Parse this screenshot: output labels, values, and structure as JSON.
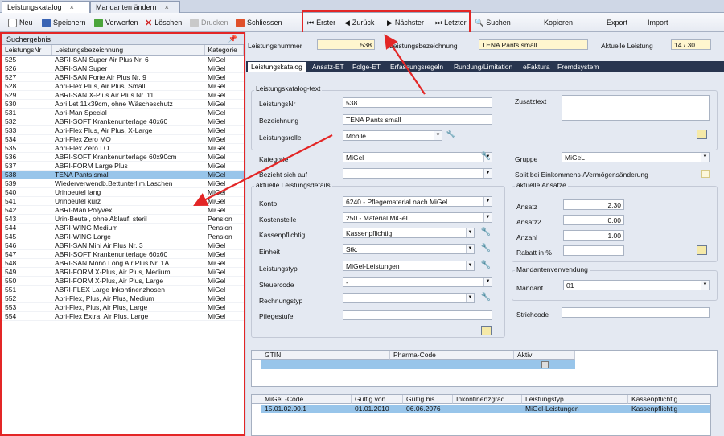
{
  "doc_tabs": [
    {
      "label": "Leistungskatalog",
      "close": "×"
    },
    {
      "label": "Mandanten ändern",
      "close": "×"
    }
  ],
  "toolbar": {
    "neu": "Neu",
    "speichern": "Speichern",
    "verwerfen": "Verwerfen",
    "loeschen": "Löschen",
    "drucken": "Drucken",
    "schliessen": "Schliessen",
    "erster": "Erster",
    "zurueck": "Zurück",
    "naechster": "Nächster",
    "letzter": "Letzter",
    "suchen": "Suchen",
    "kopieren": "Kopieren",
    "export": "Export",
    "import": "Import"
  },
  "left": {
    "title": "Suchergebnis",
    "columns": [
      "LeistungsNr",
      "Leistungsbezeichnung",
      "Kategorie"
    ],
    "rows": [
      [
        "525",
        "ABRI-SAN Super Air Plus Nr. 6",
        "MiGel"
      ],
      [
        "526",
        "ABRI-SAN Super",
        "MiGel"
      ],
      [
        "527",
        "ABRI-SAN Forte Air Plus Nr. 9",
        "MiGel"
      ],
      [
        "528",
        "Abri-Flex Plus, Air Plus, Small",
        "MiGel"
      ],
      [
        "529",
        "ABRI-SAN X-Plus Air Plus Nr. 11",
        "MiGel"
      ],
      [
        "530",
        "Abri Let 11x39cm, ohne Wäscheschutz",
        "MiGel"
      ],
      [
        "531",
        "Abri-Man Special",
        "MiGel"
      ],
      [
        "532",
        "ABRI-SOFT Krankenunterlage 40x60",
        "MiGel"
      ],
      [
        "533",
        "Abri-Flex Plus, Air Plus, X-Large",
        "MiGel"
      ],
      [
        "534",
        "Abri-Flex Zero MO",
        "MiGel"
      ],
      [
        "535",
        "Abri-Flex Zero LO",
        "MiGel"
      ],
      [
        "536",
        "ABRI-SOFT Krankenunterlage 60x90cm",
        "MiGel"
      ],
      [
        "537",
        "ABRI-FORM Large Plus",
        "MiGel"
      ],
      [
        "538",
        "TENA Pants small",
        "MiGel"
      ],
      [
        "539",
        "Wiederverwendb.Bettunterl.m.Laschen",
        "MiGel"
      ],
      [
        "540",
        "Urinbeutel lang",
        "MiGel"
      ],
      [
        "541",
        "Urinbeutel kurz",
        "MiGel"
      ],
      [
        "542",
        "ABRI-Man Polyvex",
        "MiGel"
      ],
      [
        "543",
        "Urin-Beutel, ohne Ablauf, steril",
        "Pension"
      ],
      [
        "544",
        "ABRI-WING Medium",
        "Pension"
      ],
      [
        "545",
        "ABRI-WING Large",
        "Pension"
      ],
      [
        "546",
        "ABRI-SAN Mini Air Plus Nr. 3",
        "MiGel"
      ],
      [
        "547",
        "ABRI-SOFT Krankenunterlage 60x60",
        "MiGel"
      ],
      [
        "548",
        "ABRI-SAN Mono Long Air Plus Nr. 1A",
        "MiGel"
      ],
      [
        "549",
        "ABRI-FORM  X-Plus, Air Plus, Medium",
        "MiGel"
      ],
      [
        "550",
        "ABRI-FORM X-Plus, Air Plus, Large",
        "MiGel"
      ],
      [
        "551",
        "ABRI-FLEX Large Inkontinenzhosen",
        "MiGel"
      ],
      [
        "552",
        "Abri-Flex, Plus, Air Plus, Medium",
        "MiGel"
      ],
      [
        "553",
        "Abri-Flex, Plus, Air Plus, Large",
        "MiGel"
      ],
      [
        "554",
        "Abri-Flex Extra, Air Plus, Large",
        "MiGel"
      ]
    ],
    "selected_index": 13
  },
  "header": {
    "nr_label": "Leistungsnummer",
    "nr_value": "538",
    "bez_label": "Leistungsbezeichnung",
    "bez_value": "TENA Pants small",
    "akt_label": "Aktuelle Leistung",
    "akt_value": "14 / 30"
  },
  "subtabs": [
    "Leistungskatalog",
    "Ansatz-ET",
    "Folge-ET",
    "Erfassungsregeln",
    "Rundung/Limitation",
    "eFaktura",
    "Fremdsystem"
  ],
  "form": {
    "grp_text": "Leistungskatalog-text",
    "nr_label": "LeistungsNr",
    "nr": "538",
    "bez_label": "Bezeichnung",
    "bez": "TENA Pants small",
    "rolle_label": "Leistungsrolle",
    "rolle": "Mobile",
    "zusatz_label": "Zusatztext",
    "kategorie_label": "Kategorie",
    "kategorie": "MiGel",
    "gruppe_label": "Gruppe",
    "gruppe": "MiGeL",
    "bezieht_label": "Bezieht sich auf",
    "split_label": "Split bei Einkommens-/Vermögensänderung",
    "grp_details": "aktuelle Leistungsdetails",
    "konto_label": "Konto",
    "konto": "6240 - Pflegematerial nach MiGel",
    "kst_label": "Kostenstelle",
    "kst": "250 - Material MiGeL",
    "kp_label": "Kassenpflichtig",
    "kp": "Kassenpflichtig",
    "einheit_label": "Einheit",
    "einheit": "Stk.",
    "typ_label": "Leistungstyp",
    "typ": "MiGel-Leistungen",
    "steuer_label": "Steuercode",
    "steuer": "-",
    "rtyp_label": "Rechnungstyp",
    "pflege_label": "Pflegestufe",
    "grp_ansaetze": "aktuelle Ansätze",
    "ansatz_label": "Ansatz",
    "ansatz": "2.30",
    "ansatz2_label": "Ansatz2",
    "ansatz2": "0.00",
    "anzahl_label": "Anzahl",
    "anzahl": "1.00",
    "rabatt_label": "Rabatt in %",
    "grp_mandant": "Mandantenverwendung",
    "mandant_label": "Mandant",
    "mandant": "01",
    "strich_label": "Strichcode"
  },
  "gtin_grid": {
    "columns": [
      "GTIN",
      "Pharma-Code",
      "Aktiv"
    ]
  },
  "migel_grid": {
    "columns": [
      "MiGeL-Code",
      "Gültig von",
      "Gültig bis",
      "Inkontinenzgrad",
      "Leistungstyp",
      "Kassenpflichtig"
    ],
    "row": [
      "15.01.02.00.1",
      "01.01.2010",
      "06.06.2076",
      "",
      "MiGel-Leistungen",
      "Kassenpflichtig"
    ]
  },
  "colors": {
    "highlight": "#e32626",
    "selection": "#98c5ea",
    "subtab_bar": "#28354f",
    "yellow_field": "#fff6cf"
  }
}
